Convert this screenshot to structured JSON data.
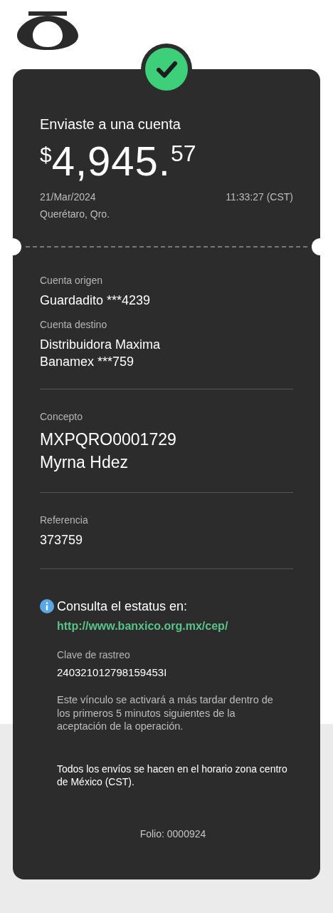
{
  "status": {
    "kind": "success"
  },
  "header": {
    "title": "Enviaste a una cuenta",
    "amount": {
      "currency": "$",
      "whole": "4,945.",
      "cents": "57"
    },
    "date": "21/Mar/2024",
    "time": "11:33:27 (CST)",
    "location": "Querétaro, Qro."
  },
  "sections": [
    {
      "fields": [
        {
          "label": "Cuenta origen",
          "lines": [
            "Guardadito ***4239"
          ],
          "kind": "regular"
        },
        {
          "label": "Cuenta destino",
          "lines": [
            "Distribuidora Maxima",
            "Banamex ***759"
          ],
          "kind": "regular"
        }
      ]
    },
    {
      "fields": [
        {
          "label": "Concepto",
          "lines": [
            "MXPQRO0001729",
            "Myrna Hdez"
          ],
          "kind": "large"
        }
      ]
    },
    {
      "fields": [
        {
          "label": "Referencia",
          "lines": [
            "373759"
          ],
          "kind": "regular"
        }
      ]
    }
  ],
  "info": {
    "heading": "Consulta el estatus en:",
    "link": "http://www.banxico.org.mx/cep/",
    "tracking_label": "Clave de rastreo",
    "tracking_code": "240321012798159453I",
    "note": "Este vínculo se activará a más tardar dentro de los primeros 5 minutos siguientes de la aceptación de la operación.",
    "schedule": "Todos los envíos se hacen en el horario zona centro de México (CST)."
  },
  "folio": "Folio: 0000924"
}
